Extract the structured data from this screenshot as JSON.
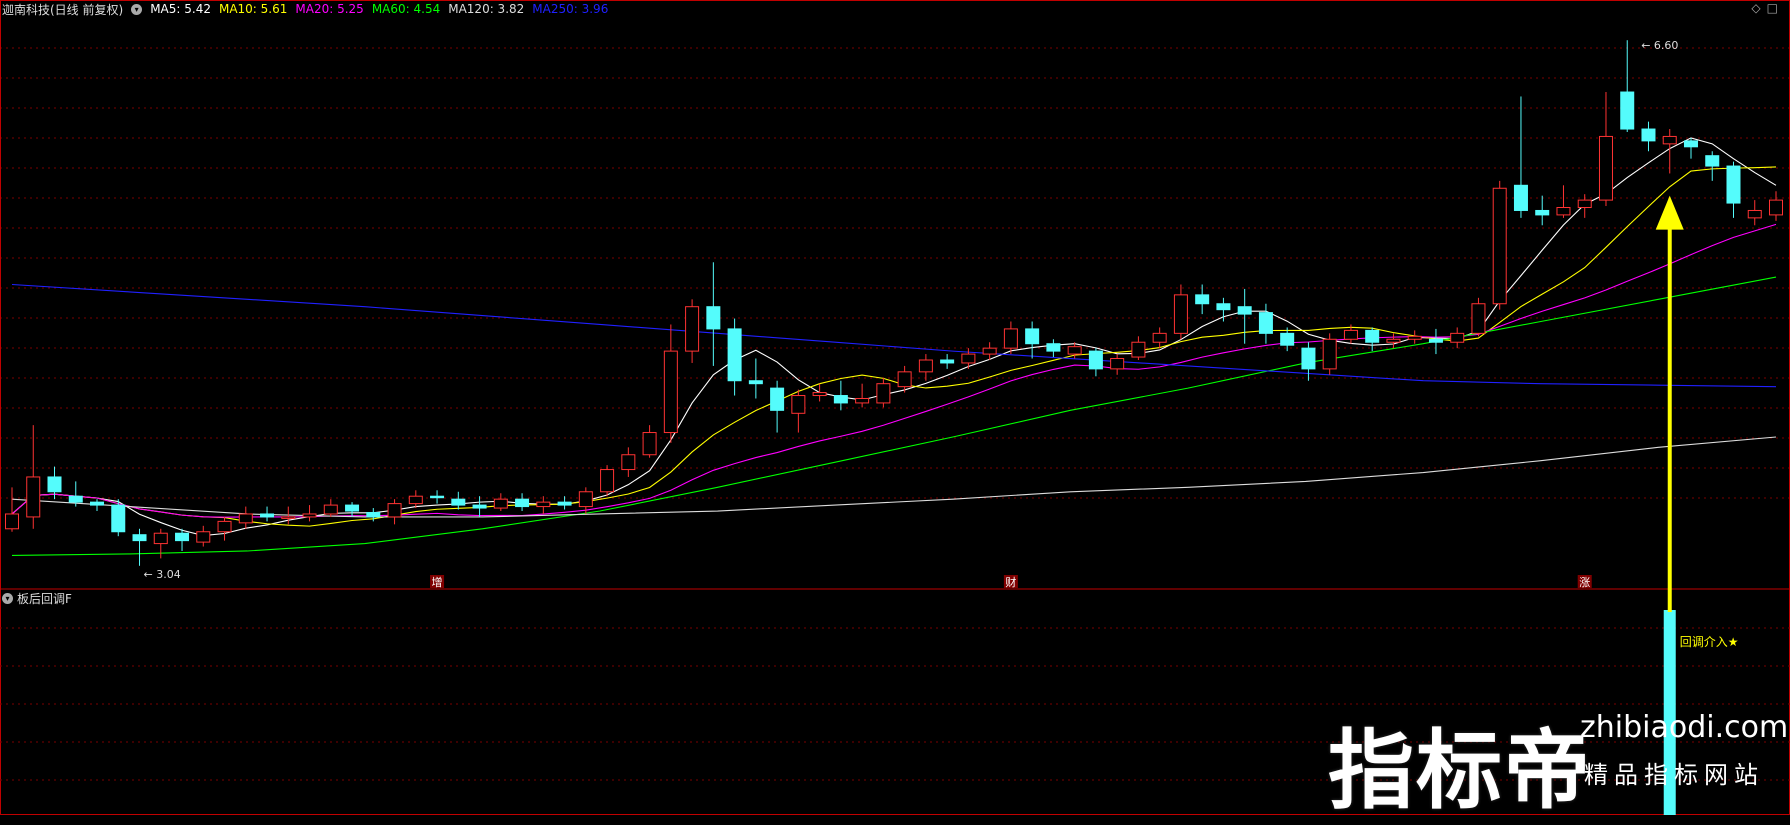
{
  "header": {
    "stock_name": "迦南科技(日线 前复权)",
    "ma": [
      {
        "label": "MA5: 5.42",
        "color": "#ffffff"
      },
      {
        "label": "MA10: 5.61",
        "color": "#ffff00"
      },
      {
        "label": "MA20: 5.25",
        "color": "#ff00ff"
      },
      {
        "label": "MA60: 4.54",
        "color": "#00ff00"
      },
      {
        "label": "MA120: 3.82",
        "color": "#dddddd"
      },
      {
        "label": "MA250: 3.96",
        "color": "#2020ff"
      }
    ]
  },
  "indicator": {
    "name": "板后回调F",
    "signal_label": "回调介入★"
  },
  "annotations": {
    "high": "6.60",
    "low": "3.04"
  },
  "markers": [
    "增",
    "财",
    "涨"
  ],
  "corner_icons": "◇□",
  "watermark": {
    "brand": "指标帝",
    "url": "zhibiaodi.com",
    "slogan": "精品指标网站"
  },
  "colors": {
    "up": "#ff3333",
    "down": "#54fcfc",
    "grid": "#7a0000",
    "divider": "#c00000"
  },
  "chart_data": {
    "type": "candlestick",
    "price_range": [
      2.9,
      6.75
    ],
    "candles": [
      [
        3.3,
        3.4,
        3.58,
        3.28
      ],
      [
        3.38,
        3.65,
        4.0,
        3.3
      ],
      [
        3.65,
        3.55,
        3.72,
        3.5
      ],
      [
        3.52,
        3.48,
        3.62,
        3.45
      ],
      [
        3.48,
        3.46,
        3.5,
        3.42
      ],
      [
        3.46,
        3.28,
        3.5,
        3.25
      ],
      [
        3.26,
        3.22,
        3.3,
        3.05
      ],
      [
        3.2,
        3.27,
        3.3,
        3.1
      ],
      [
        3.27,
        3.22,
        3.3,
        3.15
      ],
      [
        3.21,
        3.28,
        3.32,
        3.18
      ],
      [
        3.28,
        3.35,
        3.38,
        3.22
      ],
      [
        3.34,
        3.4,
        3.45,
        3.3
      ],
      [
        3.4,
        3.38,
        3.45,
        3.35
      ],
      [
        3.37,
        3.38,
        3.45,
        3.33
      ],
      [
        3.38,
        3.4,
        3.46,
        3.35
      ],
      [
        3.4,
        3.46,
        3.5,
        3.38
      ],
      [
        3.46,
        3.42,
        3.48,
        3.38
      ],
      [
        3.41,
        3.38,
        3.44,
        3.35
      ],
      [
        3.38,
        3.47,
        3.5,
        3.33
      ],
      [
        3.47,
        3.52,
        3.56,
        3.44
      ],
      [
        3.52,
        3.51,
        3.56,
        3.47
      ],
      [
        3.5,
        3.46,
        3.55,
        3.43
      ],
      [
        3.46,
        3.44,
        3.52,
        3.38
      ],
      [
        3.44,
        3.5,
        3.54,
        3.42
      ],
      [
        3.5,
        3.45,
        3.54,
        3.42
      ],
      [
        3.45,
        3.48,
        3.52,
        3.4
      ],
      [
        3.48,
        3.46,
        3.52,
        3.43
      ],
      [
        3.45,
        3.55,
        3.58,
        3.4
      ],
      [
        3.55,
        3.7,
        3.73,
        3.52
      ],
      [
        3.7,
        3.8,
        3.85,
        3.65
      ],
      [
        3.8,
        3.95,
        4.0,
        3.78
      ],
      [
        3.95,
        4.5,
        4.68,
        3.88
      ],
      [
        4.5,
        4.8,
        4.85,
        4.42
      ],
      [
        4.8,
        4.65,
        5.1,
        4.4
      ],
      [
        4.65,
        4.3,
        4.72,
        4.2
      ],
      [
        4.3,
        4.28,
        4.45,
        4.18
      ],
      [
        4.25,
        4.1,
        4.3,
        3.95
      ],
      [
        4.08,
        4.2,
        4.24,
        3.95
      ],
      [
        4.2,
        4.22,
        4.28,
        4.16
      ],
      [
        4.2,
        4.15,
        4.3,
        4.1
      ],
      [
        4.15,
        4.18,
        4.28,
        4.12
      ],
      [
        4.15,
        4.28,
        4.32,
        4.12
      ],
      [
        4.26,
        4.36,
        4.4,
        4.22
      ],
      [
        4.36,
        4.44,
        4.48,
        4.3
      ],
      [
        4.44,
        4.42,
        4.48,
        4.38
      ],
      [
        4.42,
        4.48,
        4.52,
        4.38
      ],
      [
        4.48,
        4.52,
        4.56,
        4.44
      ],
      [
        4.52,
        4.65,
        4.7,
        4.48
      ],
      [
        4.65,
        4.55,
        4.7,
        4.45
      ],
      [
        4.55,
        4.5,
        4.58,
        4.46
      ],
      [
        4.48,
        4.53,
        4.56,
        4.45
      ],
      [
        4.5,
        4.38,
        4.52,
        4.33
      ],
      [
        4.38,
        4.45,
        4.48,
        4.34
      ],
      [
        4.46,
        4.56,
        4.6,
        4.44
      ],
      [
        4.56,
        4.62,
        4.66,
        4.52
      ],
      [
        4.62,
        4.88,
        4.95,
        4.58
      ],
      [
        4.88,
        4.82,
        4.95,
        4.75
      ],
      [
        4.82,
        4.78,
        4.86,
        4.7
      ],
      [
        4.8,
        4.75,
        4.92,
        4.55
      ],
      [
        4.76,
        4.62,
        4.82,
        4.55
      ],
      [
        4.62,
        4.54,
        4.66,
        4.5
      ],
      [
        4.52,
        4.38,
        4.56,
        4.3
      ],
      [
        4.38,
        4.58,
        4.62,
        4.34
      ],
      [
        4.58,
        4.64,
        4.68,
        4.55
      ],
      [
        4.64,
        4.56,
        4.66,
        4.5
      ],
      [
        4.56,
        4.58,
        4.62,
        4.52
      ],
      [
        4.58,
        4.6,
        4.64,
        4.55
      ],
      [
        4.58,
        4.56,
        4.65,
        4.48
      ],
      [
        4.56,
        4.62,
        4.66,
        4.52
      ],
      [
        4.62,
        4.82,
        4.86,
        4.6
      ],
      [
        4.82,
        5.6,
        5.65,
        4.78
      ],
      [
        5.62,
        5.45,
        6.22,
        5.4
      ],
      [
        5.45,
        5.42,
        5.55,
        5.35
      ],
      [
        5.42,
        5.47,
        5.62,
        5.4
      ],
      [
        5.47,
        5.52,
        5.56,
        5.4
      ],
      [
        5.52,
        5.95,
        6.25,
        5.48
      ],
      [
        6.25,
        6.0,
        6.6,
        5.98
      ],
      [
        6.0,
        5.92,
        6.05,
        5.85
      ],
      [
        5.9,
        5.95,
        6.0,
        5.7
      ],
      [
        5.92,
        5.88,
        5.94,
        5.8
      ],
      [
        5.82,
        5.75,
        5.85,
        5.65
      ],
      [
        5.75,
        5.5,
        5.78,
        5.4
      ],
      [
        5.4,
        5.45,
        5.52,
        5.35
      ],
      [
        5.42,
        5.52,
        5.58,
        5.38
      ]
    ]
  }
}
